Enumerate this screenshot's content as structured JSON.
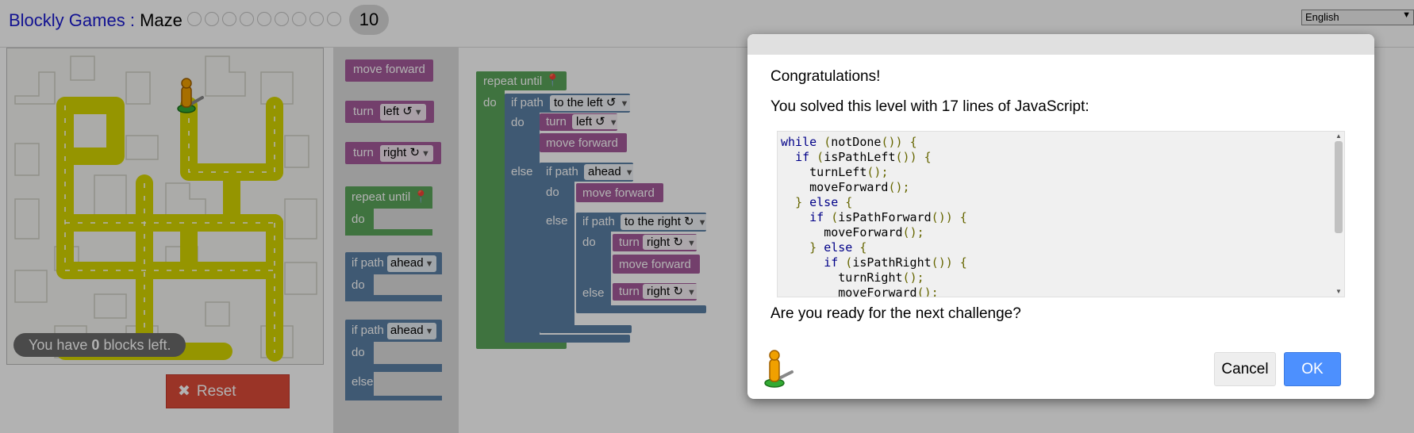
{
  "header": {
    "app_title": "Blockly Games",
    "separator": " : ",
    "game_title": "Maze",
    "current_level": "10",
    "language": "English"
  },
  "maze": {
    "blocks_left_prefix": "You have ",
    "blocks_left_count": "0",
    "blocks_left_suffix": " blocks left.",
    "reset_label": "Reset"
  },
  "toolbox": {
    "move_forward": "move forward",
    "turn": "turn",
    "left": "left ↺",
    "right": "right ↻",
    "repeat_until": "repeat until",
    "do": "do",
    "if_path": "if path",
    "ahead": "ahead",
    "else": "else"
  },
  "workspace": {
    "repeat_until": "repeat until",
    "do": "do",
    "if_path": "if path",
    "to_the_left": "to the left ↺",
    "ahead": "ahead",
    "to_the_right": "to the right ↻",
    "turn": "turn",
    "left": "left ↺",
    "right": "right ↻",
    "move_forward": "move forward",
    "else": "else"
  },
  "dialog": {
    "congrats": "Congratulations!",
    "solved": "You solved this level with 17 lines of JavaScript:",
    "code_lines": [
      "while (notDone()) {",
      "  if (isPathLeft()) {",
      "    turnLeft();",
      "    moveForward();",
      "  } else {",
      "    if (isPathForward()) {",
      "      moveForward();",
      "    } else {",
      "      if (isPathRight()) {",
      "        turnRight();",
      "        moveForward();"
    ],
    "question": "Are you ready for the next challenge?",
    "cancel": "Cancel",
    "ok": "OK"
  },
  "colors": {
    "movement_block": "#a55b9b",
    "loop_block": "#5ba55b",
    "logic_block": "#5b80a5",
    "reset_button": "#dd4b39",
    "ok_button": "#4d90fe",
    "path": "#d6d600"
  }
}
